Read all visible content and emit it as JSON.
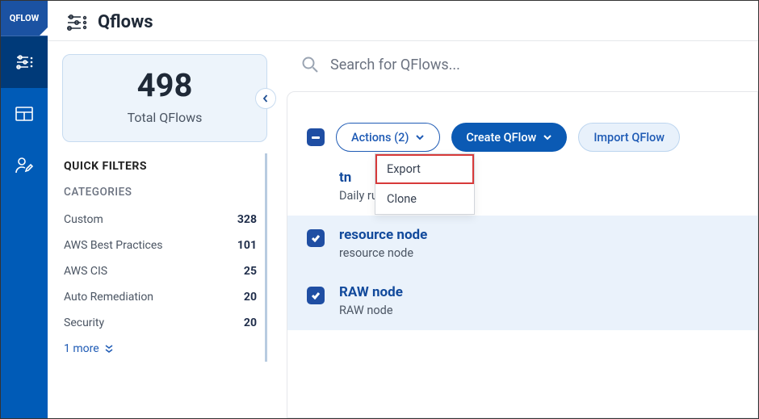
{
  "app_label": "QFLOW",
  "page_title": "Qflows",
  "total": {
    "count": "498",
    "label": "Total QFlows"
  },
  "quick_filters_heading": "QUICK FILTERS",
  "categories_heading": "CATEGORIES",
  "categories": [
    {
      "label": "Custom",
      "count": "328"
    },
    {
      "label": "AWS Best Practices",
      "count": "101"
    },
    {
      "label": "AWS CIS",
      "count": "25"
    },
    {
      "label": "Auto Remediation",
      "count": "20"
    },
    {
      "label": "Security",
      "count": "20"
    }
  ],
  "more_label": "1 more",
  "search_placeholder": "Search for QFlows...",
  "toolbar": {
    "actions_label": "Actions (2)",
    "create_label": "Create QFlow",
    "import_label": "Import QFlow"
  },
  "actions_menu": {
    "export": "Export",
    "clone": "Clone"
  },
  "rows": [
    {
      "title": "tn",
      "sub": "Daily run (Every hour)",
      "selected": false,
      "show_check": false
    },
    {
      "title": "resource node",
      "sub": "resource node",
      "selected": true,
      "show_check": true
    },
    {
      "title": "RAW node",
      "sub": "RAW node",
      "selected": true,
      "show_check": true
    }
  ]
}
